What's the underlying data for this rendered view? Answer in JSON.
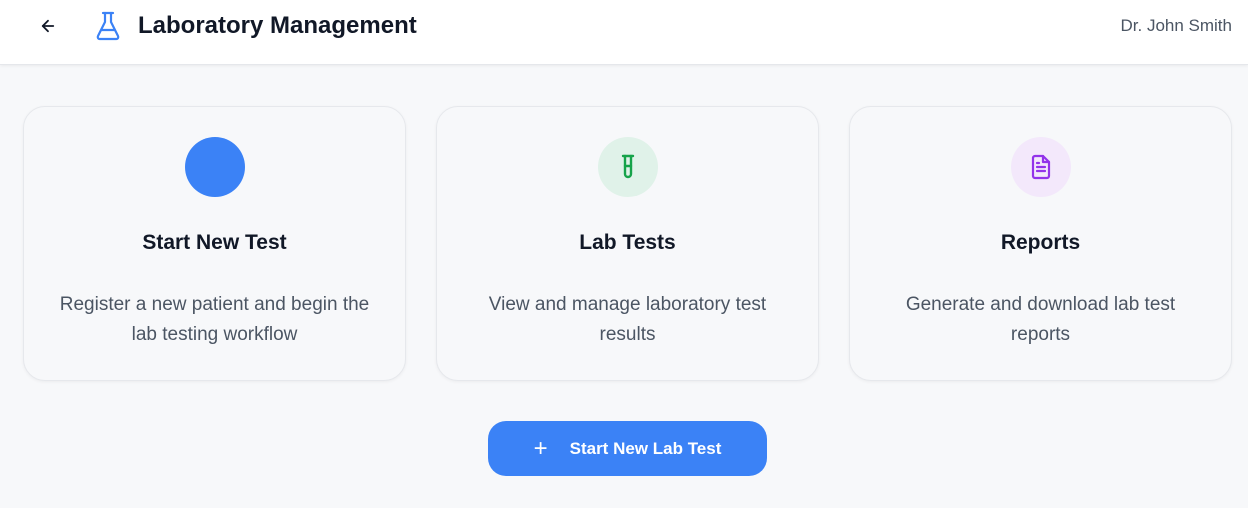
{
  "header": {
    "title": "Laboratory Management",
    "user": "Dr. John Smith",
    "back_icon": "arrow-left-icon",
    "app_icon": "flask-icon"
  },
  "cards": [
    {
      "title": "Start New Test",
      "description": "Register a new patient and begin the lab testing workflow",
      "icon": "blue-circle",
      "accent": "#3b82f6"
    },
    {
      "title": "Lab Tests",
      "description": "View and manage laboratory test results",
      "icon": "test-tube-icon",
      "accent": "#16a34a",
      "icon_bg": "#e0f2e9"
    },
    {
      "title": "Reports",
      "description": "Generate and download lab test reports",
      "icon": "document-icon",
      "accent": "#9333ea",
      "icon_bg": "#f3e8fb"
    }
  ],
  "cta": {
    "label": "Start New Lab Test",
    "icon": "plus-icon",
    "color": "#3b82f6"
  }
}
